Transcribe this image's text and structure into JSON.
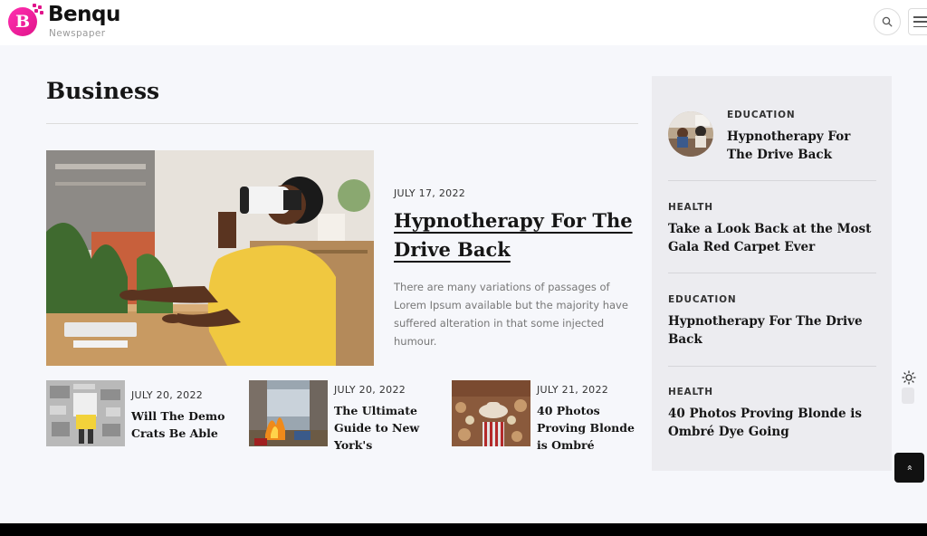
{
  "brand": {
    "logo_letter": "B",
    "name": "Benqu",
    "tagline": "Newspaper",
    "accent_color": "#e0148a"
  },
  "header": {
    "search_icon": "search-icon",
    "menu_icon": "hamburger-menu-icon"
  },
  "section": {
    "title": "Business"
  },
  "featured": {
    "date": "JULY 17, 2022",
    "title": "Hypnotherapy For The Drive Back",
    "excerpt": "There are many variations of passages of Lorem Ipsum available but the majority have suffered alteration in that some injected humour.",
    "image": "vr-headset-person-photo"
  },
  "small_posts": [
    {
      "date": "JULY 20, 2022",
      "title": "Will The Demo Crats Be Able",
      "image": "newspaper-reader-photo"
    },
    {
      "date": "JULY 20, 2022",
      "title": "The Ultimate Guide to New York's",
      "image": "street-fire-photo"
    },
    {
      "date": "JULY 21, 2022",
      "title": "40 Photos Proving Blonde is Ombré",
      "image": "market-hat-photo"
    }
  ],
  "sidebar": {
    "items": [
      {
        "category": "EDUCATION",
        "title": "Hypnotherapy For The Drive Back",
        "has_avatar": true
      },
      {
        "category": "HEALTH",
        "title": "Take a Look Back at the Most Gala Red Carpet Ever"
      },
      {
        "category": "EDUCATION",
        "title": "Hypnotherapy For The Drive Back"
      },
      {
        "category": "HEALTH",
        "title": "40 Photos Proving Blonde is Ombré Dye Going"
      }
    ]
  },
  "widgets": {
    "theme_icon": "sun-icon",
    "scroll_top_icon": "double-chevron-up-icon",
    "scroll_top_glyph": "»"
  }
}
